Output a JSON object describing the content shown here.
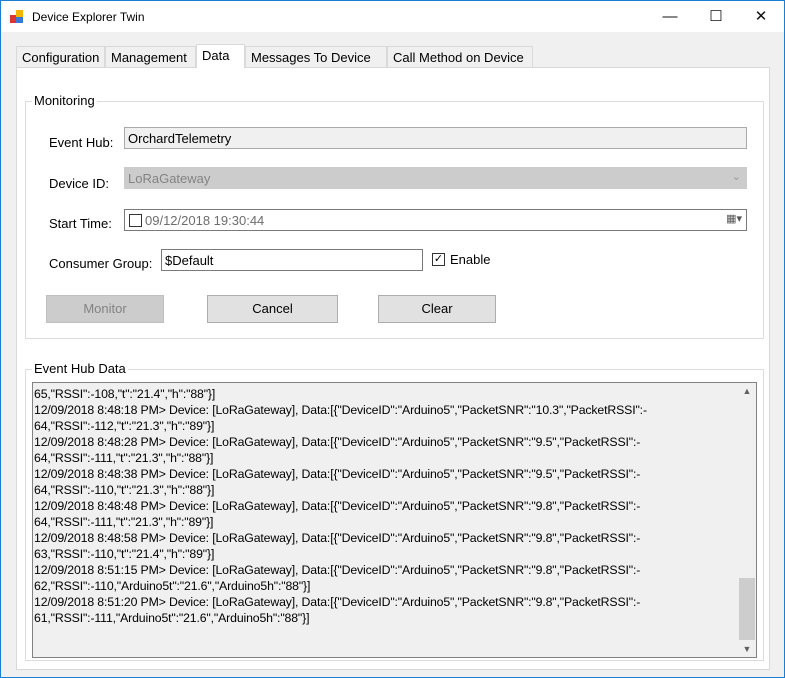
{
  "window": {
    "title": "Device Explorer Twin",
    "minimize": "—",
    "maximize": "☐",
    "close": "✕"
  },
  "tabs": [
    {
      "label": "Configuration"
    },
    {
      "label": "Management"
    },
    {
      "label": "Data"
    },
    {
      "label": "Messages To Device"
    },
    {
      "label": "Call Method on Device"
    }
  ],
  "monitoring": {
    "title": "Monitoring",
    "event_hub_label": "Event Hub:",
    "event_hub_value": "OrchardTelemetry",
    "device_id_label": "Device ID:",
    "device_id_value": "LoRaGateway",
    "start_time_label": "Start Time:",
    "start_time_value": "09/12/2018 19:30:44",
    "start_time_checked": false,
    "consumer_group_label": "Consumer Group:",
    "consumer_group_value": "$Default",
    "enable_label": "Enable",
    "enable_checked": true,
    "monitor_button": "Monitor",
    "cancel_button": "Cancel",
    "clear_button": "Clear"
  },
  "event_hub_data": {
    "title": "Event Hub Data",
    "lines": [
      "65,\"RSSI\":-108,\"t\":\"21.4\",\"h\":\"88\"}]",
      "12/09/2018 8:48:18 PM> Device: [LoRaGateway], Data:[{\"DeviceID\":\"Arduino5\",\"PacketSNR\":\"10.3\",\"PacketRSSI\":-",
      "64,\"RSSI\":-112,\"t\":\"21.3\",\"h\":\"89\"}]",
      "12/09/2018 8:48:28 PM> Device: [LoRaGateway], Data:[{\"DeviceID\":\"Arduino5\",\"PacketSNR\":\"9.5\",\"PacketRSSI\":-",
      "64,\"RSSI\":-111,\"t\":\"21.3\",\"h\":\"88\"}]",
      "12/09/2018 8:48:38 PM> Device: [LoRaGateway], Data:[{\"DeviceID\":\"Arduino5\",\"PacketSNR\":\"9.5\",\"PacketRSSI\":-",
      "64,\"RSSI\":-110,\"t\":\"21.3\",\"h\":\"88\"}]",
      "12/09/2018 8:48:48 PM> Device: [LoRaGateway], Data:[{\"DeviceID\":\"Arduino5\",\"PacketSNR\":\"9.8\",\"PacketRSSI\":-",
      "64,\"RSSI\":-111,\"t\":\"21.3\",\"h\":\"89\"}]",
      "12/09/2018 8:48:58 PM> Device: [LoRaGateway], Data:[{\"DeviceID\":\"Arduino5\",\"PacketSNR\":\"9.8\",\"PacketRSSI\":-",
      "63,\"RSSI\":-110,\"t\":\"21.4\",\"h\":\"89\"}]",
      "12/09/2018 8:51:15 PM> Device: [LoRaGateway], Data:[{\"DeviceID\":\"Arduino5\",\"PacketSNR\":\"9.8\",\"PacketRSSI\":-",
      "62,\"RSSI\":-110,\"Arduino5t\":\"21.6\",\"Arduino5h\":\"88\"}]",
      "12/09/2018 8:51:20 PM> Device: [LoRaGateway], Data:[{\"DeviceID\":\"Arduino5\",\"PacketSNR\":\"9.8\",\"PacketRSSI\":-",
      "61,\"RSSI\":-111,\"Arduino5t\":\"21.6\",\"Arduino5h\":\"88\"}]"
    ]
  },
  "colors": {
    "accent": "#1a7fd4",
    "disabled": "#cccccc"
  }
}
